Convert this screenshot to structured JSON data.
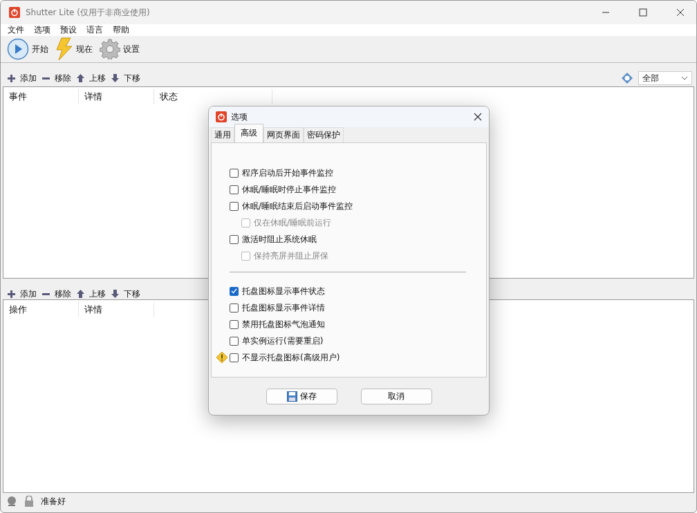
{
  "window": {
    "title": "Shutter Lite (仅用于非商业使用)"
  },
  "menu": [
    "文件",
    "选项",
    "预设",
    "语言",
    "帮助"
  ],
  "toolbar": [
    {
      "label": "开始",
      "kind": "play"
    },
    {
      "label": "现在",
      "kind": "bolt"
    },
    {
      "label": "设置",
      "kind": "gear"
    }
  ],
  "events_toolbar": {
    "buttons": [
      {
        "label": "添加",
        "kind": "add"
      },
      {
        "label": "移除",
        "kind": "remove"
      },
      {
        "label": "上移",
        "kind": "up"
      },
      {
        "label": "下移",
        "kind": "down"
      }
    ],
    "filter": {
      "value": "全部"
    }
  },
  "events_table": {
    "columns": [
      "事件",
      "详情",
      "状态"
    ]
  },
  "actions_toolbar": {
    "buttons": [
      {
        "label": "添加",
        "kind": "add"
      },
      {
        "label": "移除",
        "kind": "remove"
      },
      {
        "label": "上移",
        "kind": "up"
      },
      {
        "label": "下移",
        "kind": "down"
      }
    ]
  },
  "actions_table": {
    "columns": [
      "操作",
      "详情"
    ]
  },
  "status_bar": {
    "text": "准备好"
  },
  "dialog": {
    "title": "选项",
    "tabs": [
      {
        "label": "通用",
        "selected": false
      },
      {
        "label": "高级",
        "selected": true
      },
      {
        "label": "网页界面",
        "selected": false
      },
      {
        "label": "密码保护",
        "selected": false
      }
    ],
    "option_groups": [
      [
        {
          "label": "程序启动后开始事件监控",
          "checked": false,
          "disabled": false,
          "warning": false
        },
        {
          "label": "休眠/睡眠时停止事件监控",
          "checked": false,
          "disabled": false,
          "warning": false
        },
        {
          "label": "休眠/睡眠结束后启动事件监控",
          "checked": false,
          "disabled": false,
          "warning": false,
          "children": [
            {
              "label": "仅在休眠/睡眠前运行",
              "checked": false,
              "disabled": true,
              "warning": false
            }
          ]
        },
        {
          "label": "激活时阻止系统休眠",
          "checked": false,
          "disabled": false,
          "warning": false,
          "children": [
            {
              "label": "保持亮屏并阻止屏保",
              "checked": false,
              "disabled": true,
              "warning": false
            }
          ]
        }
      ],
      [
        {
          "label": "托盘图标显示事件状态",
          "checked": true,
          "disabled": false,
          "warning": false
        },
        {
          "label": "托盘图标显示事件详情",
          "checked": false,
          "disabled": false,
          "warning": false
        },
        {
          "label": "禁用托盘图标气泡通知",
          "checked": false,
          "disabled": false,
          "warning": false
        },
        {
          "label": "单实例运行(需要重启)",
          "checked": false,
          "disabled": false,
          "warning": false
        },
        {
          "label": "不显示托盘图标(高级用户)",
          "checked": false,
          "disabled": false,
          "warning": true
        }
      ]
    ],
    "buttons": [
      {
        "label": "保存",
        "kind": "save"
      },
      {
        "label": "取消",
        "kind": "plain"
      }
    ]
  }
}
